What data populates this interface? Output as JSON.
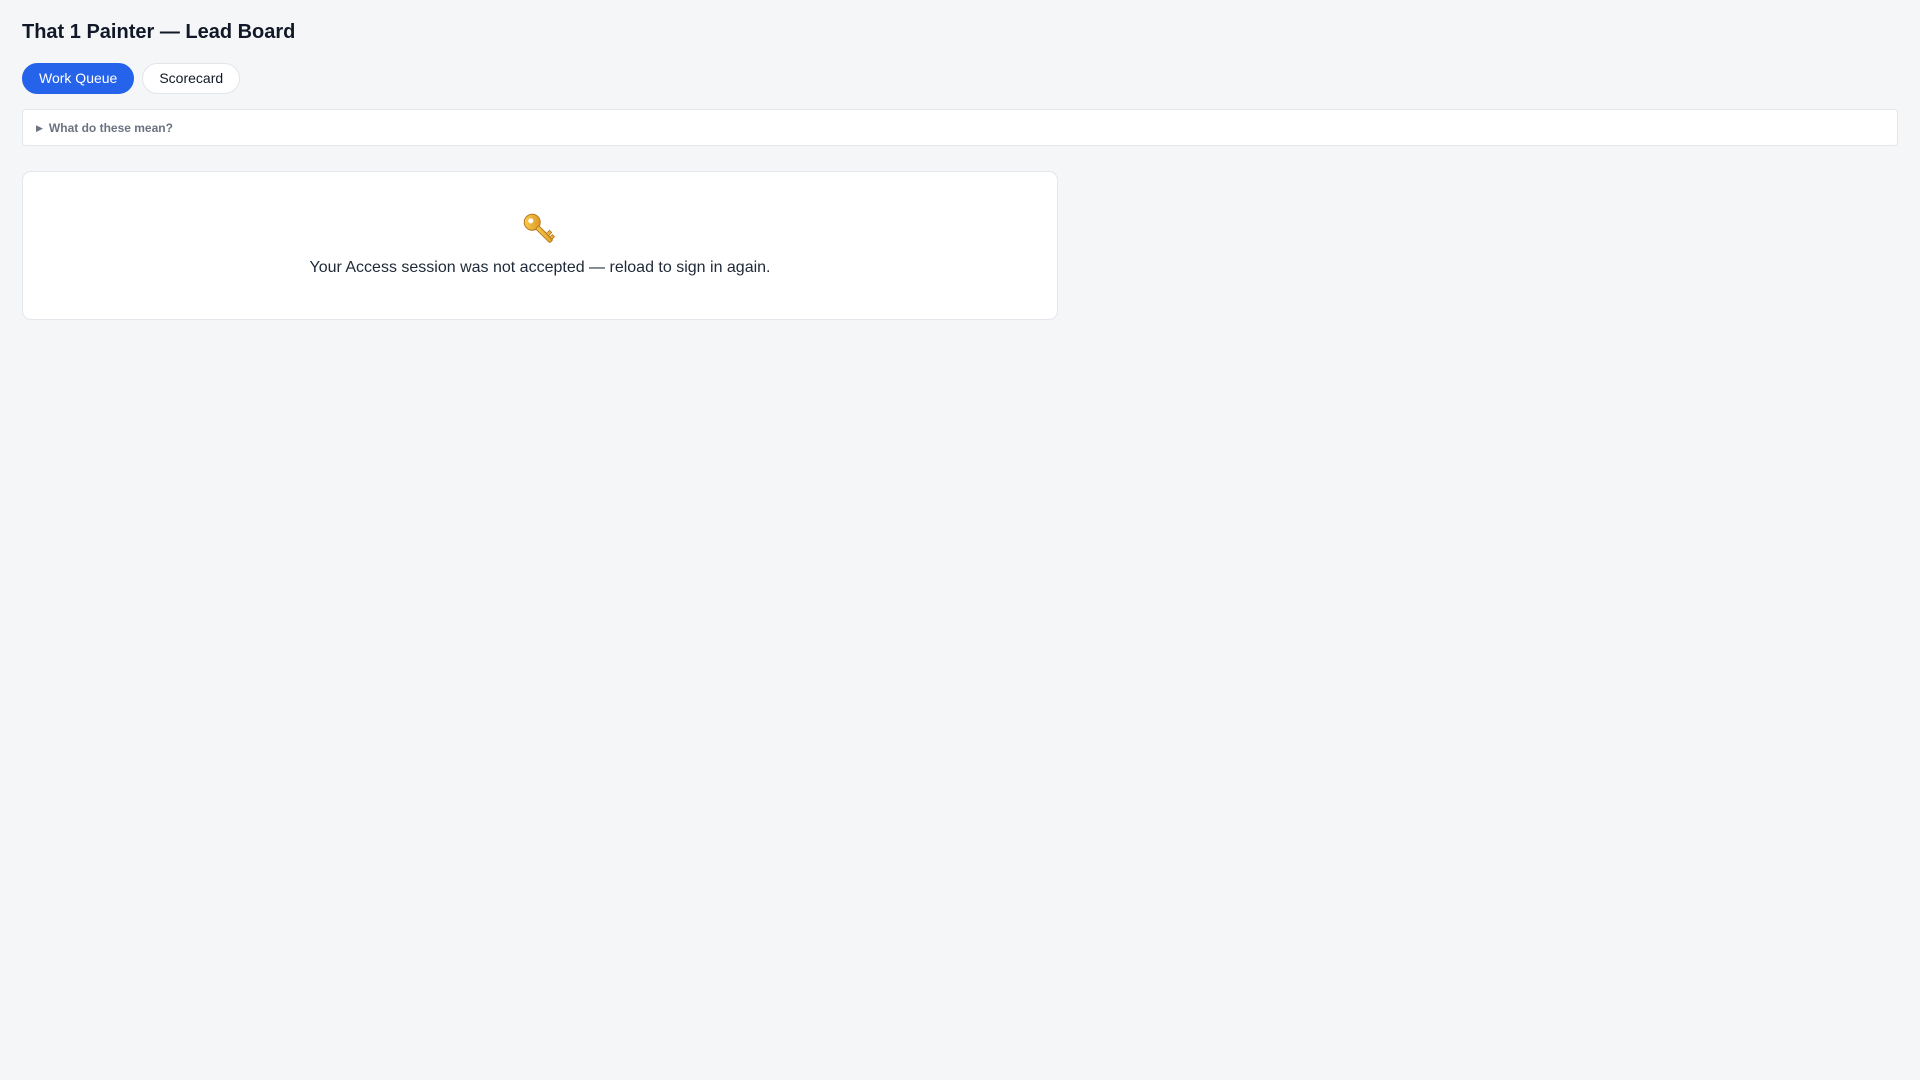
{
  "header": {
    "title": "That 1 Painter — Lead Board"
  },
  "tabs": [
    {
      "label": "Work Queue",
      "active": true
    },
    {
      "label": "Scorecard",
      "active": false
    }
  ],
  "help": {
    "label": "What do these mean?",
    "expanded": false
  },
  "status_card": {
    "icon": "key-icon",
    "message": "Your Access session was not accepted — reload to sign in again."
  },
  "colors": {
    "accent": "#2563eb",
    "background": "#f5f6f8",
    "key_gold": "#e8a317"
  }
}
